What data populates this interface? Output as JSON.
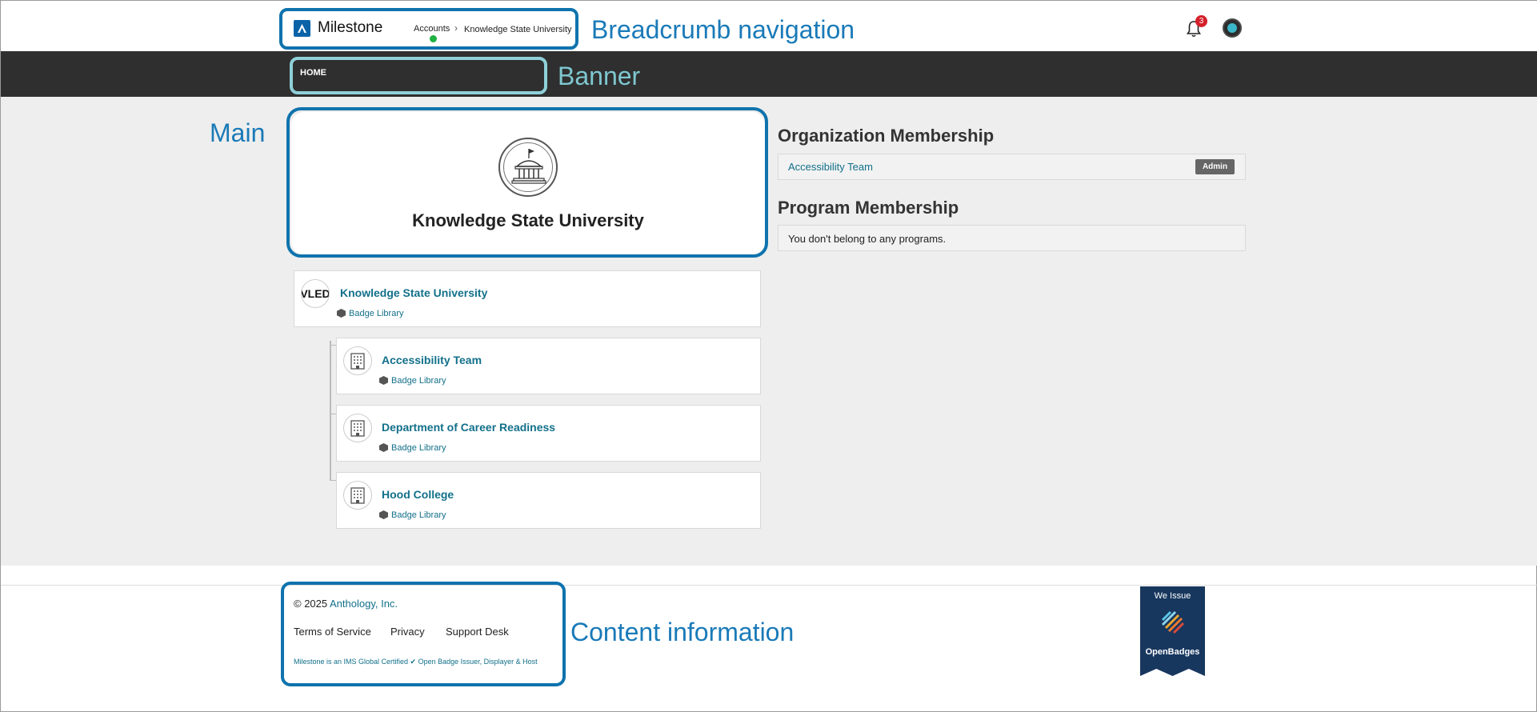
{
  "annotations": {
    "breadcrumb": "Breadcrumb navigation",
    "banner": "Banner",
    "main": "Main",
    "content_info": "Content information"
  },
  "header": {
    "app_name": "Milestone",
    "breadcrumb": [
      "Accounts",
      "Knowledge State University"
    ],
    "notification_count": "3"
  },
  "banner": {
    "home": "HOME"
  },
  "hero": {
    "title": "Knowledge State University"
  },
  "tree": {
    "root": {
      "avatar_text": "VLED",
      "name": "Knowledge State University",
      "library": "Badge Library"
    },
    "children": [
      {
        "name": "Accessibility Team",
        "library": "Badge Library"
      },
      {
        "name": "Department of Career Readiness",
        "library": "Badge Library"
      },
      {
        "name": "Hood College",
        "library": "Badge Library"
      }
    ]
  },
  "org_membership": {
    "title": "Organization Membership",
    "items": [
      {
        "name": "Accessibility Team",
        "role": "Admin"
      }
    ]
  },
  "program_membership": {
    "title": "Program Membership",
    "empty": "You don't belong to any programs."
  },
  "footer": {
    "copyright_prefix": "© 2025 ",
    "company": "Anthology, Inc.",
    "links": [
      "Terms of Service",
      "Privacy",
      "Support Desk"
    ],
    "cert_text": "Milestone is an IMS Global Certified ✔ Open Badge Issuer, Displayer & Host",
    "badge_top": "We Issue",
    "badge_bottom": "OpenBadges"
  },
  "colors": {
    "accent": "#12708a",
    "annotation_dark": "#0f73ad",
    "annotation_light": "#8fd0d8",
    "banner": "#2f2f2f",
    "main_bg": "#eeeeee"
  },
  "icons": [
    "milestone-logo-icon",
    "bell-icon",
    "user-avatar-icon",
    "university-building-icon",
    "office-building-icon",
    "badge-library-icon",
    "openbadges-logo-icon"
  ]
}
